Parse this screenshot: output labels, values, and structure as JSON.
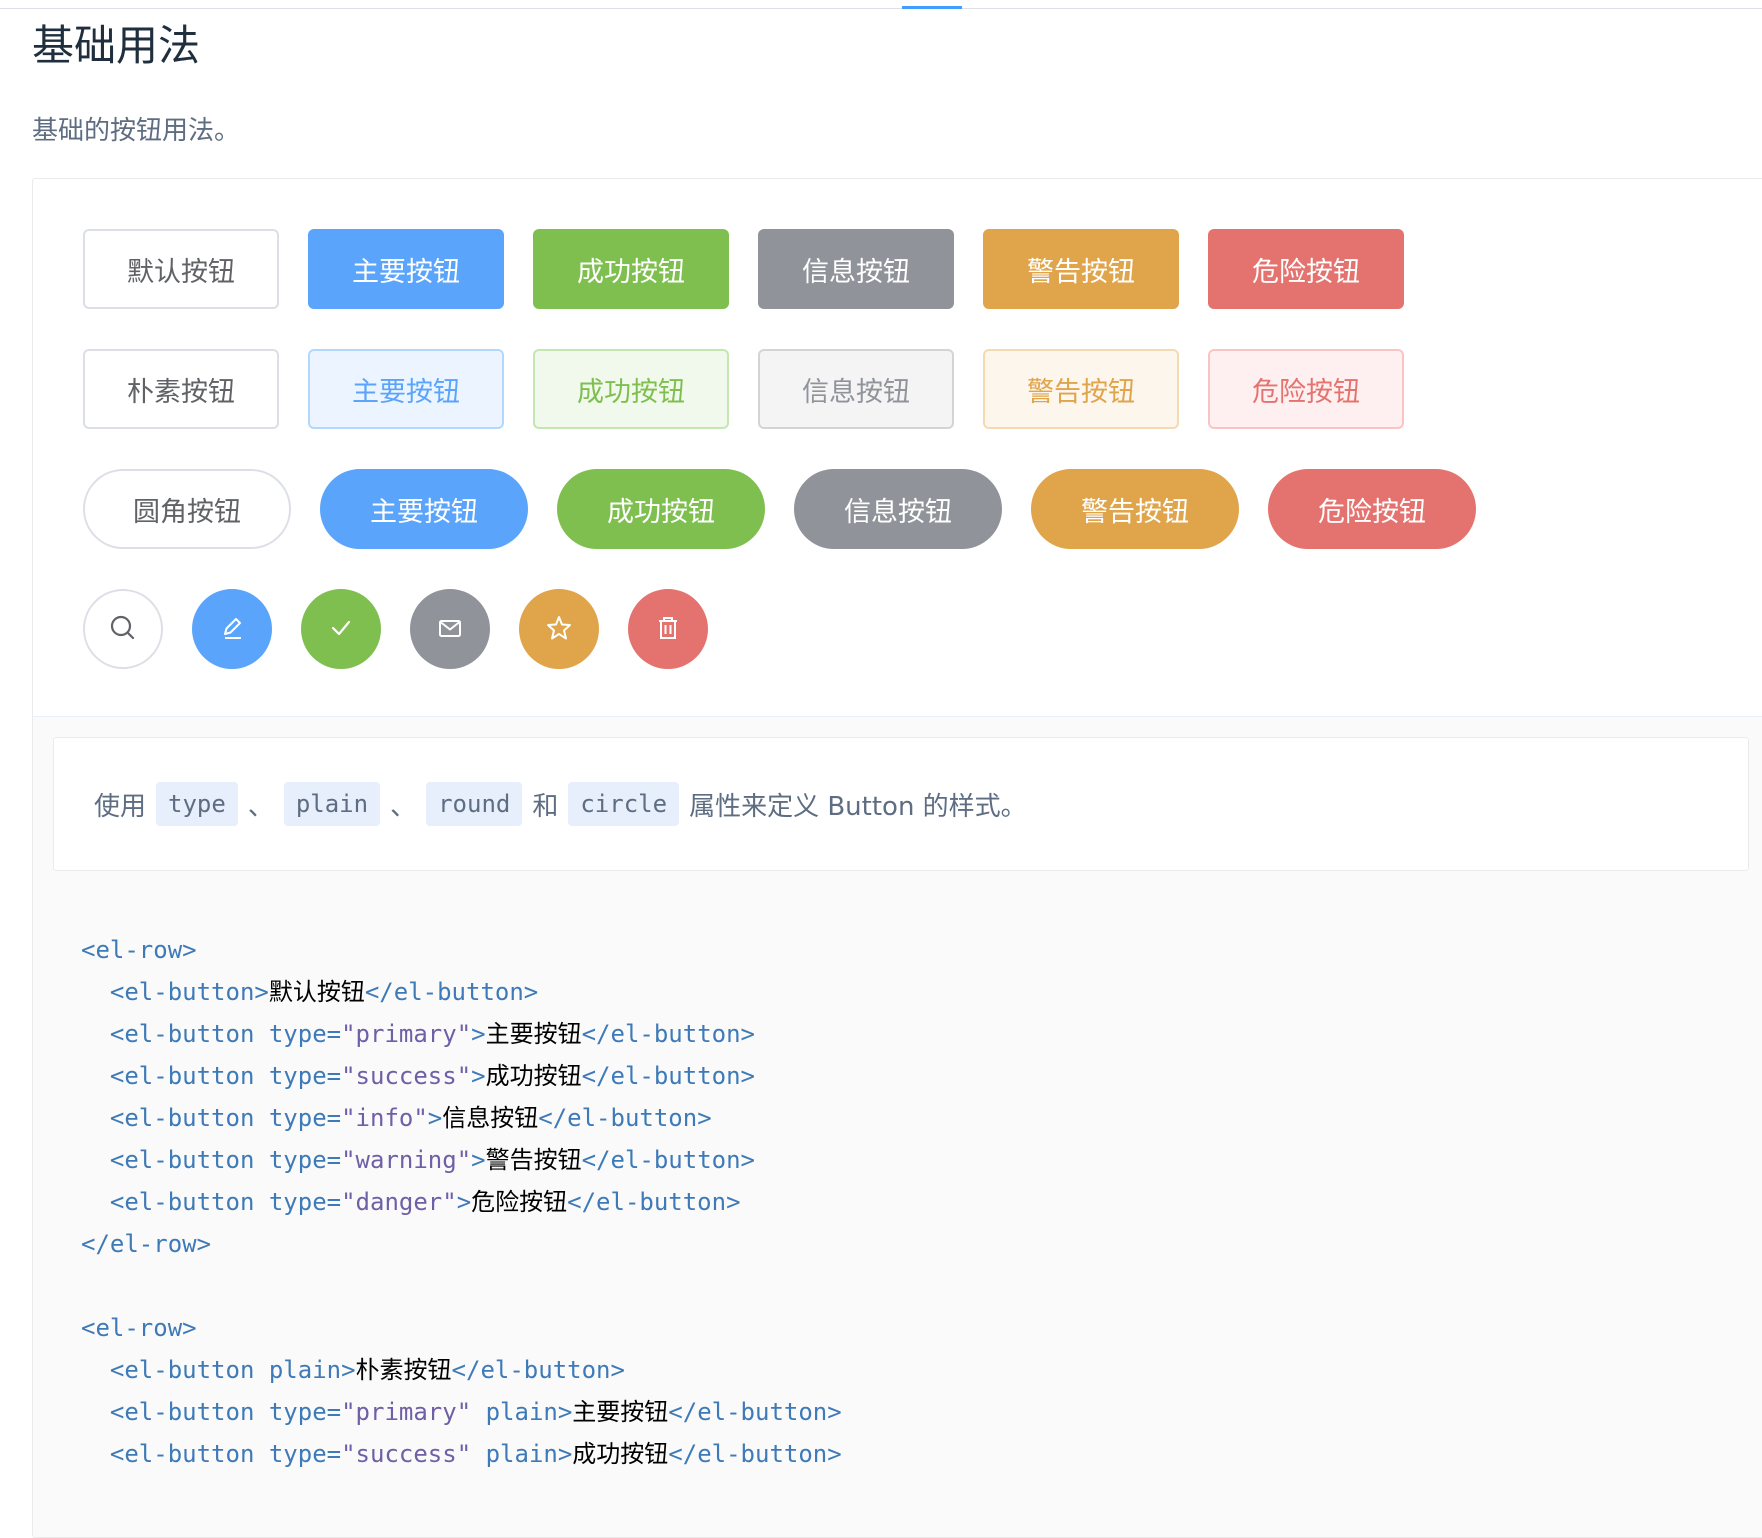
{
  "page": {
    "title": "基础用法",
    "description": "基础的按钮用法。"
  },
  "buttons": {
    "row1": [
      {
        "label": "默认按钮",
        "type": "default"
      },
      {
        "label": "主要按钮",
        "type": "primary"
      },
      {
        "label": "成功按钮",
        "type": "success"
      },
      {
        "label": "信息按钮",
        "type": "info"
      },
      {
        "label": "警告按钮",
        "type": "warning"
      },
      {
        "label": "危险按钮",
        "type": "danger"
      }
    ],
    "row2": [
      {
        "label": "朴素按钮",
        "type": "default"
      },
      {
        "label": "主要按钮",
        "type": "primary"
      },
      {
        "label": "成功按钮",
        "type": "success"
      },
      {
        "label": "信息按钮",
        "type": "info"
      },
      {
        "label": "警告按钮",
        "type": "warning"
      },
      {
        "label": "危险按钮",
        "type": "danger"
      }
    ],
    "row3": [
      {
        "label": "圆角按钮",
        "type": "default"
      },
      {
        "label": "主要按钮",
        "type": "primary"
      },
      {
        "label": "成功按钮",
        "type": "success"
      },
      {
        "label": "信息按钮",
        "type": "info"
      },
      {
        "label": "警告按钮",
        "type": "warning"
      },
      {
        "label": "危险按钮",
        "type": "danger"
      }
    ],
    "row4": [
      {
        "icon": "search-icon",
        "type": "default"
      },
      {
        "icon": "edit-icon",
        "type": "primary"
      },
      {
        "icon": "check-icon",
        "type": "success"
      },
      {
        "icon": "message-icon",
        "type": "info"
      },
      {
        "icon": "star-icon",
        "type": "warning"
      },
      {
        "icon": "delete-icon",
        "type": "danger"
      }
    ]
  },
  "meta": {
    "desc_prefix": "使用",
    "code_type": "type",
    "sep1": "、",
    "code_plain": "plain",
    "sep2": "、",
    "code_round": "round",
    "and": "和",
    "code_circle": "circle",
    "desc_suffix": "属性来定义 Button 的样式。"
  },
  "code_lines": [
    "<el-row>",
    "  <el-button>默认按钮</el-button>",
    "  <el-button type=\"primary\">主要按钮</el-button>",
    "  <el-button type=\"success\">成功按钮</el-button>",
    "  <el-button type=\"info\">信息按钮</el-button>",
    "  <el-button type=\"warning\">警告按钮</el-button>",
    "  <el-button type=\"danger\">危险按钮</el-button>",
    "</el-row>",
    "",
    "<el-row>",
    "  <el-button plain>朴素按钮</el-button>",
    "  <el-button type=\"primary\" plain>主要按钮</el-button>",
    "  <el-button type=\"success\" plain>成功按钮</el-button>"
  ],
  "colors": {
    "primary": "#5aa4fb",
    "success": "#7fbf50",
    "info": "#909399",
    "warning": "#e0a44b",
    "danger": "#e4736f"
  }
}
